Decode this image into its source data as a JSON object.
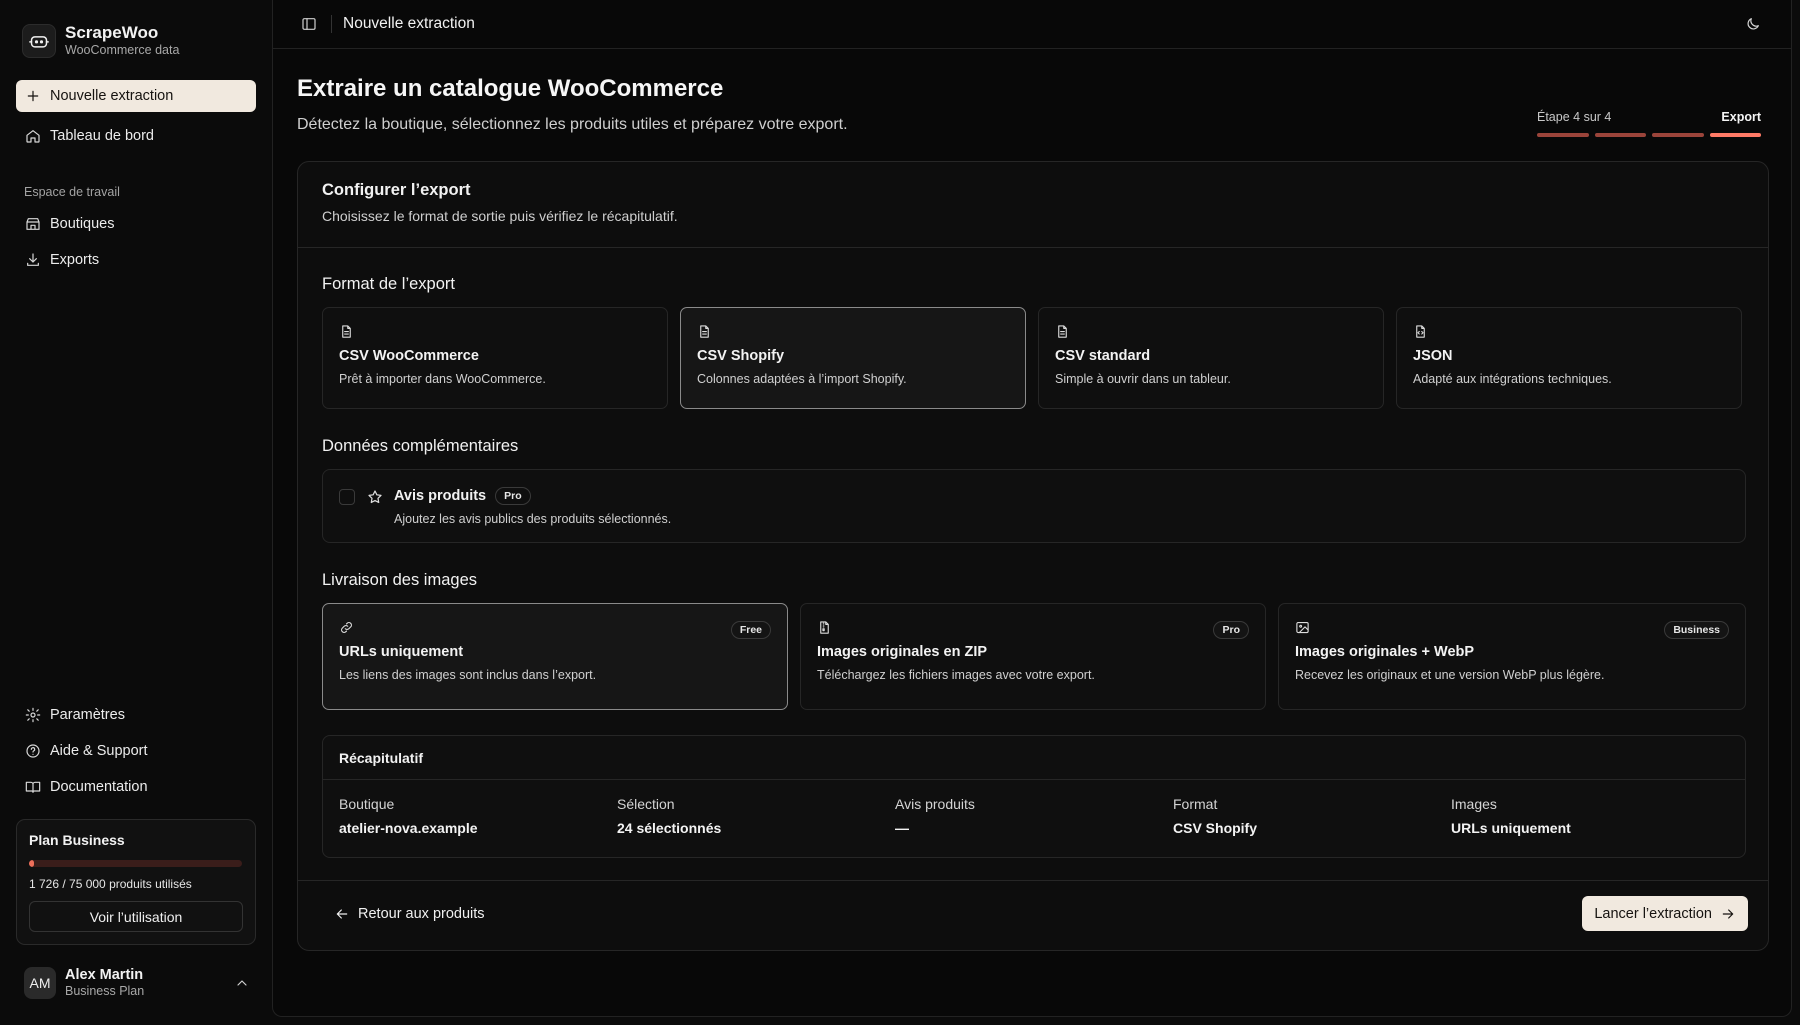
{
  "app": {
    "name": "ScrapeWoo",
    "tagline": "WooCommerce data"
  },
  "sidebar": {
    "new_extraction": "Nouvelle extraction",
    "dashboard": "Tableau de bord",
    "group_label": "Espace de travail",
    "items": [
      "Boutiques",
      "Exports"
    ],
    "settings": "Paramètres",
    "help": "Aide & Support",
    "docs": "Documentation",
    "plan": {
      "title": "Plan Business",
      "usage_text": "1 726 / 75 000 produits utilisés",
      "used": 1726,
      "total": 75000,
      "button": "Voir l’utilisation"
    },
    "user": {
      "initials": "AM",
      "name": "Alex Martin",
      "plan": "Business Plan"
    }
  },
  "topbar": {
    "breadcrumb": "Nouvelle extraction"
  },
  "page": {
    "title": "Extraire un catalogue WooCommerce",
    "subtitle": "Détectez la boutique, sélectionnez les produits utiles et préparez votre export."
  },
  "stepper": {
    "label": "Étape 4 sur 4",
    "name": "Export",
    "current": 4,
    "total": 4
  },
  "card": {
    "title": "Configurer l’export",
    "subtitle": "Choisissez le format de sortie puis vérifiez le récapitulatif.",
    "format_section": "Format de l’export",
    "formats": [
      {
        "icon": "file-icon",
        "title": "CSV WooCommerce",
        "desc": "Prêt à importer dans WooCommerce.",
        "selected": false
      },
      {
        "icon": "file-icon",
        "title": "CSV Shopify",
        "desc": "Colonnes adaptées à l’import Shopify.",
        "selected": true
      },
      {
        "icon": "file-icon",
        "title": "CSV standard",
        "desc": "Simple à ouvrir dans un tableur.",
        "selected": false
      },
      {
        "icon": "file-code-icon",
        "title": "JSON",
        "desc": "Adapté aux intégrations techniques.",
        "selected": false
      }
    ],
    "extra_section": "Données complémentaires",
    "reviews": {
      "title": "Avis produits",
      "badge": "Pro",
      "desc": "Ajoutez les avis publics des produits sélectionnés.",
      "checked": false
    },
    "images_section": "Livraison des images",
    "images": [
      {
        "icon": "link-icon",
        "title": "URLs uniquement",
        "desc": "Les liens des images sont inclus dans l’export.",
        "badge": "Free",
        "selected": true
      },
      {
        "icon": "file-archive-icon",
        "title": "Images originales en ZIP",
        "desc": "Téléchargez les fichiers images avec votre export.",
        "badge": "Pro",
        "selected": false
      },
      {
        "icon": "image-icon",
        "title": "Images originales + WebP",
        "desc": "Recevez les originaux et une version WebP plus légère.",
        "badge": "Business",
        "selected": false
      }
    ],
    "summary": {
      "title": "Récapitulatif",
      "cols": [
        {
          "label": "Boutique",
          "value": "atelier-nova.example"
        },
        {
          "label": "Sélection",
          "value": "24 sélectionnés"
        },
        {
          "label": "Avis produits",
          "value": "—"
        },
        {
          "label": "Format",
          "value": "CSV Shopify"
        },
        {
          "label": "Images",
          "value": "URLs uniquement"
        }
      ]
    },
    "back_button": "Retour aux produits",
    "launch_button": "Lancer l’extraction"
  },
  "colors": {
    "accent": "#f1e9df",
    "progress": "#ff7a66",
    "progress_dim": "#9b443a",
    "background": "#0b0b0b"
  }
}
